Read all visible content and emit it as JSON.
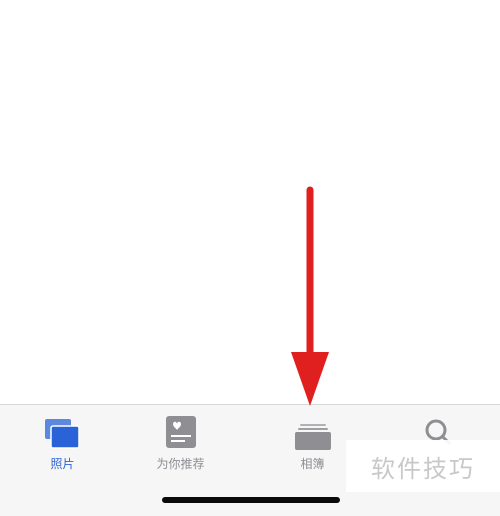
{
  "tab_bar": {
    "tabs": [
      {
        "label": "照片",
        "icon": "photos-stack-icon",
        "active": true
      },
      {
        "label": "为你推荐",
        "icon": "for-you-card-icon",
        "active": false
      },
      {
        "label": "相簿",
        "icon": "albums-folder-icon",
        "active": false
      },
      {
        "label": "",
        "icon": "search-icon",
        "active": false
      }
    ]
  },
  "watermark": {
    "text": "软件技巧"
  },
  "colors": {
    "accent": "#2a63d8",
    "inactive": "#8e8e93",
    "arrow": "#e01f1f",
    "tab_bar_bg": "#f6f6f7"
  }
}
